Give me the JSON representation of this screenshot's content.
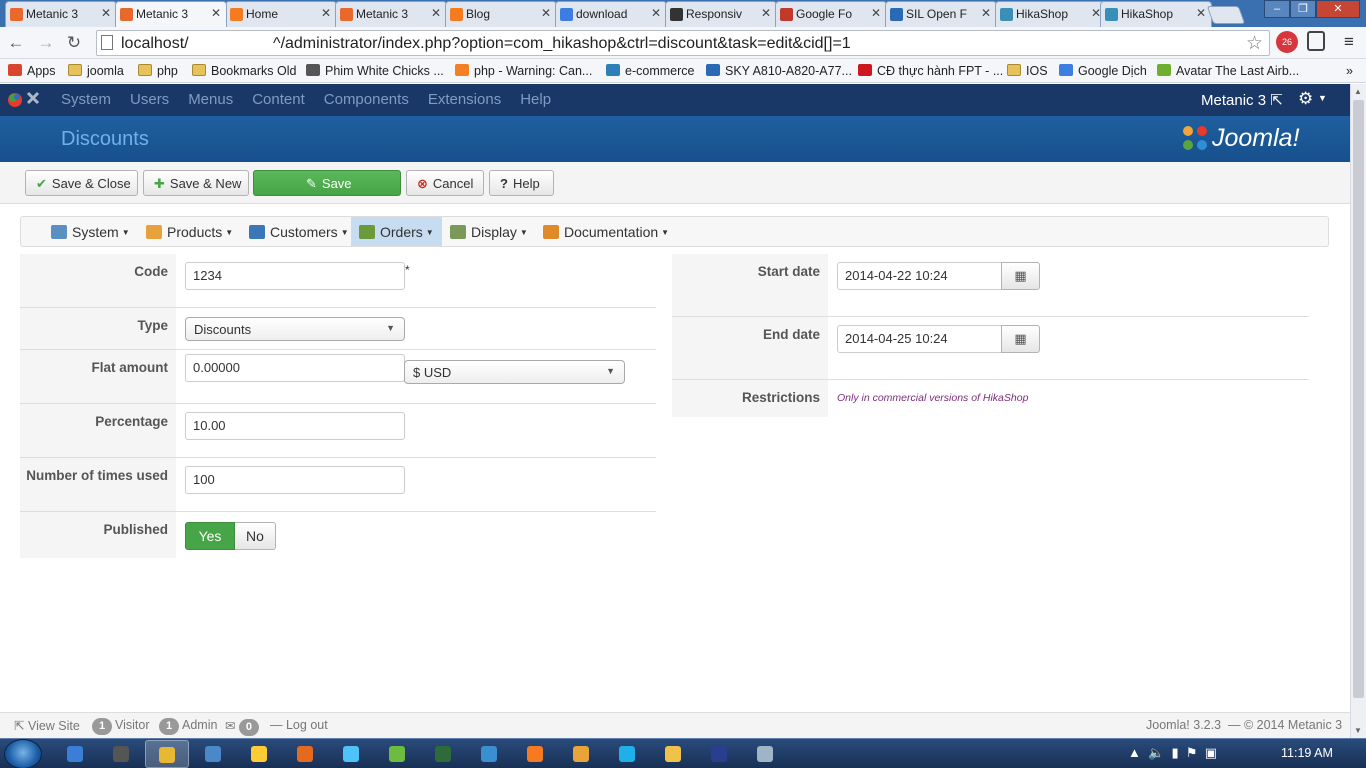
{
  "browser": {
    "tabs": [
      {
        "label": "Metanic 3",
        "icon": "joomla-icon",
        "color": "#e8692b",
        "active": false
      },
      {
        "label": "Metanic 3",
        "icon": "joomla-icon",
        "color": "#e8692b",
        "active": true
      },
      {
        "label": "Home",
        "icon": "xampp-icon",
        "color": "#f57a20",
        "active": false
      },
      {
        "label": "Metanic 3",
        "icon": "joomla-icon",
        "color": "#e8692b",
        "active": false
      },
      {
        "label": "Blog",
        "icon": "xampp-icon",
        "color": "#f57a20",
        "active": false
      },
      {
        "label": "download",
        "icon": "google-icon",
        "color": "#3b7de0",
        "active": false
      },
      {
        "label": "Responsiv",
        "icon": "joomla-dark-icon",
        "color": "#333333",
        "active": false
      },
      {
        "label": "Google Fo",
        "icon": "doc-icon",
        "color": "#c0392b",
        "active": false
      },
      {
        "label": "SIL Open F",
        "icon": "sil-icon",
        "color": "#2a6ab5",
        "active": false
      },
      {
        "label": "HikaShop",
        "icon": "hikashop-icon",
        "color": "#3a8fb7",
        "active": false
      },
      {
        "label": "HikaShop",
        "icon": "hikashop-icon",
        "color": "#3a8fb7",
        "active": false
      }
    ],
    "url": "localhost/                   ^/administrator/index.php?option=com_hikashop&ctrl=discount&task=edit&cid[]=1",
    "ext_badge": "26",
    "bookmarks": [
      {
        "label": "Apps",
        "icon": "apps-icon",
        "color": "#d9462f"
      },
      {
        "label": "joomla",
        "icon": "folder-icon",
        "color": "#e7c15a"
      },
      {
        "label": "php",
        "icon": "folder-icon",
        "color": "#e7c15a"
      },
      {
        "label": "Bookmarks Old",
        "icon": "folder-icon",
        "color": "#e7c15a"
      },
      {
        "label": "Phim White Chicks ...",
        "icon": "film-icon",
        "color": "#555555"
      },
      {
        "label": "php - Warning: Can...",
        "icon": "stackoverflow-icon",
        "color": "#f48024"
      },
      {
        "label": "e-commerce",
        "icon": "gear-icon",
        "color": "#2d7fb8"
      },
      {
        "label": "SKY A810-A820-A77...",
        "icon": "sky-icon",
        "color": "#2a6ab5"
      },
      {
        "label": "CĐ thực hành FPT - ...",
        "icon": "youtube-icon",
        "color": "#cc181e"
      },
      {
        "label": "IOS",
        "icon": "folder-icon",
        "color": "#e7c15a"
      },
      {
        "label": "Google Dịch",
        "icon": "translate-icon",
        "color": "#3b7de0"
      },
      {
        "label": "Avatar The Last Airb...",
        "icon": "z-icon",
        "color": "#6fae2f"
      }
    ]
  },
  "joomla": {
    "menu": [
      "System",
      "Users",
      "Menus",
      "Content",
      "Components",
      "Extensions",
      "Help"
    ],
    "site_name": "Metanic 3",
    "page_title": "Discounts",
    "brand": "Joomla!",
    "colors": {
      "nav_bg": "#1a3867",
      "title_bg": "#1d5a99",
      "save_green": "#46a546"
    }
  },
  "toolbar": {
    "save_close": "Save & Close",
    "save_new": "Save & New",
    "save": "Save",
    "cancel": "Cancel",
    "help": "Help"
  },
  "hikamenu": {
    "items": [
      {
        "label": "System",
        "icon": "tools-icon",
        "color": "#5a8fc4",
        "active": false
      },
      {
        "label": "Products",
        "icon": "box-icon",
        "color": "#e9a23b",
        "active": false
      },
      {
        "label": "Customers",
        "icon": "users-icon",
        "color": "#3a76b8",
        "active": false
      },
      {
        "label": "Orders",
        "icon": "orders-icon",
        "color": "#6a9a3a",
        "active": true
      },
      {
        "label": "Display",
        "icon": "display-icon",
        "color": "#7a9a5a",
        "active": false
      },
      {
        "label": "Documentation",
        "icon": "docs-icon",
        "color": "#e08a2a",
        "active": false
      }
    ]
  },
  "form": {
    "code": {
      "label": "Code",
      "value": "1234",
      "required_mark": "*"
    },
    "type": {
      "label": "Type",
      "value": "Discounts"
    },
    "flat_amount": {
      "label": "Flat amount",
      "value": "0.00000",
      "currency": "$ USD"
    },
    "percentage": {
      "label": "Percentage",
      "value": "10.00"
    },
    "times_used": {
      "label": "Number of times used",
      "value": "100"
    },
    "published": {
      "label": "Published",
      "yes": "Yes",
      "no": "No",
      "value": "Yes"
    },
    "start_date": {
      "label": "Start date",
      "value": "2014-04-22 10:24"
    },
    "end_date": {
      "label": "End date",
      "value": "2014-04-25 10:24"
    },
    "restrictions": {
      "label": "Restrictions",
      "note": "Only in commercial versions of HikaShop"
    }
  },
  "status": {
    "view_site": "View Site",
    "visitors": {
      "count": "1",
      "label": "Visitor"
    },
    "admins": {
      "count": "1",
      "label": "Admin"
    },
    "messages": {
      "count": "0"
    },
    "logout": "Log out",
    "version": "Joomla! 3.2.3",
    "copyright": "— © 2014 Metanic 3"
  },
  "taskbar": {
    "apps": [
      "ie-icon",
      "media-icon",
      "chrome-icon",
      "explorer-icon",
      "app-icon",
      "firefox-icon",
      "game-icon",
      "refresh-icon",
      "terminal-icon",
      "network-icon",
      "xampp-icon",
      "settings-icon",
      "skype-icon",
      "folder-icon",
      "photoshop-icon",
      "tool-icon"
    ],
    "time": "11:19 AM"
  }
}
